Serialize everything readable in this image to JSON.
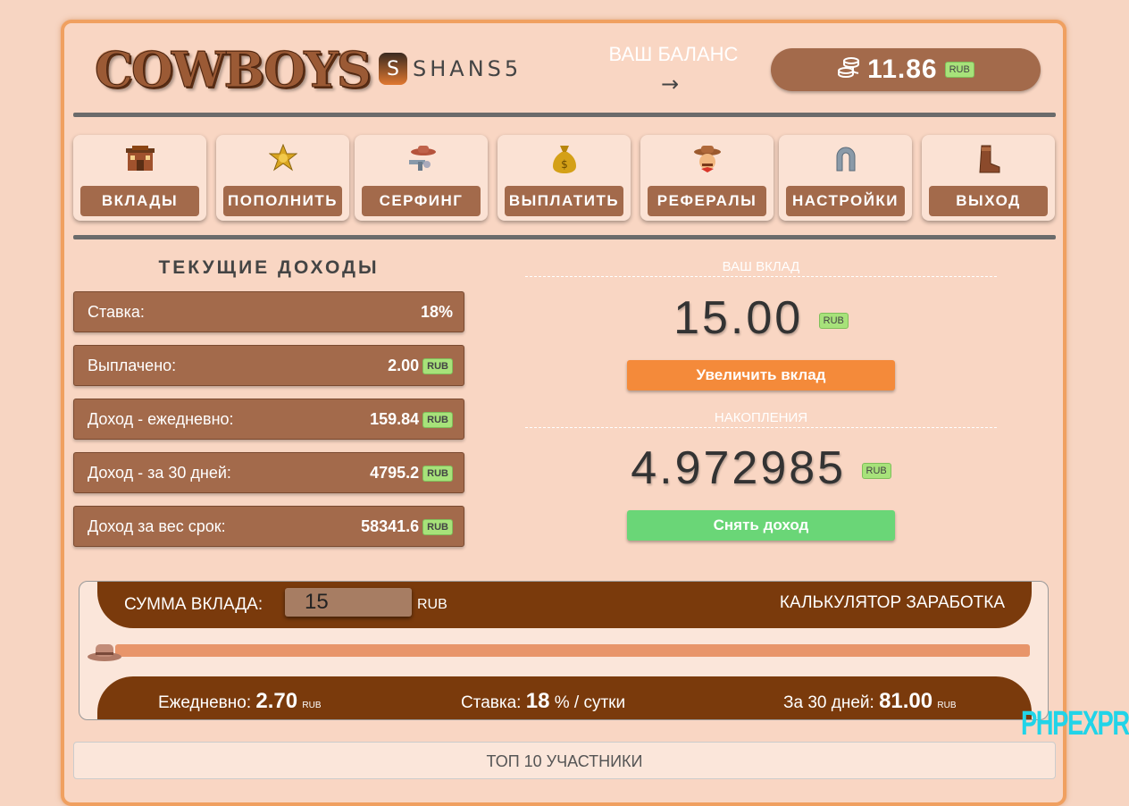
{
  "header": {
    "logo_text": "COWBOYS",
    "brand_letter": "S",
    "brand_name": "SHANS5",
    "balance_label": "ВАШ БАЛАНС",
    "balance_value": "11.86",
    "currency": "RUB"
  },
  "menu": [
    {
      "icon": "saloon-icon",
      "glyph": "🏚",
      "label": "ВКЛАДЫ"
    },
    {
      "icon": "sheriff-star-icon",
      "glyph": "⭐",
      "label": "ПОПОЛНИТЬ"
    },
    {
      "icon": "cowboy-hat-gun-icon",
      "glyph": "🤠",
      "label": "СЕРФИНГ"
    },
    {
      "icon": "money-bag-icon",
      "glyph": "💰",
      "label": "ВЫПЛАТИТЬ"
    },
    {
      "icon": "cowboy-face-icon",
      "glyph": "🤠",
      "label": "РЕФЕРАЛЫ"
    },
    {
      "icon": "horseshoe-icon",
      "glyph": "∩",
      "label": "НАСТРОЙКИ"
    },
    {
      "icon": "boot-icon",
      "glyph": "👢",
      "label": "ВЫХОД"
    }
  ],
  "income": {
    "title": "ТЕКУЩИЕ ДОХОДЫ",
    "rows": [
      {
        "label": "Ставка:",
        "value": "18%",
        "currency": ""
      },
      {
        "label": "Выплачено:",
        "value": "2.00",
        "currency": "RUB"
      },
      {
        "label": "Доход - ежедневно:",
        "value": "159.84",
        "currency": "RUB"
      },
      {
        "label": "Доход - за 30 дней:",
        "value": "4795.2",
        "currency": "RUB"
      },
      {
        "label": "Доход за вес срок:",
        "value": "58341.6",
        "currency": "RUB"
      }
    ]
  },
  "deposit": {
    "caption": "ВАШ ВКЛАД",
    "value": "15.00",
    "currency": "RUB",
    "button": "Увеличить вклад"
  },
  "savings": {
    "caption": "НАКОПЛЕНИЯ",
    "value": "4.972985",
    "currency": "RUB",
    "button": "Снять доход"
  },
  "calculator": {
    "sum_label": "СУММА ВКЛАДА:",
    "sum_value": "15",
    "sum_currency": "RUB",
    "title": "КАЛЬКУЛЯТОР ЗАРАБОТКА",
    "daily_label": "Ежедневно:",
    "daily_value": "2.70",
    "rate_label": "Ставка:",
    "rate_value": "18",
    "rate_unit": "% / сутки",
    "month_label": "За 30 дней:",
    "month_value": "81.00",
    "currency_small": "RUB"
  },
  "top10": "ТОП 10 УЧАСТНИКИ",
  "watermark": {
    "part1": "PHP",
    "part2": "EXPRESS"
  },
  "colors": {
    "brown": "#a36a4b",
    "dark_brown": "#7a3a0c",
    "orange_button": "#f48a3a",
    "green_button": "#6ad677",
    "background": "#f7d5c2"
  }
}
